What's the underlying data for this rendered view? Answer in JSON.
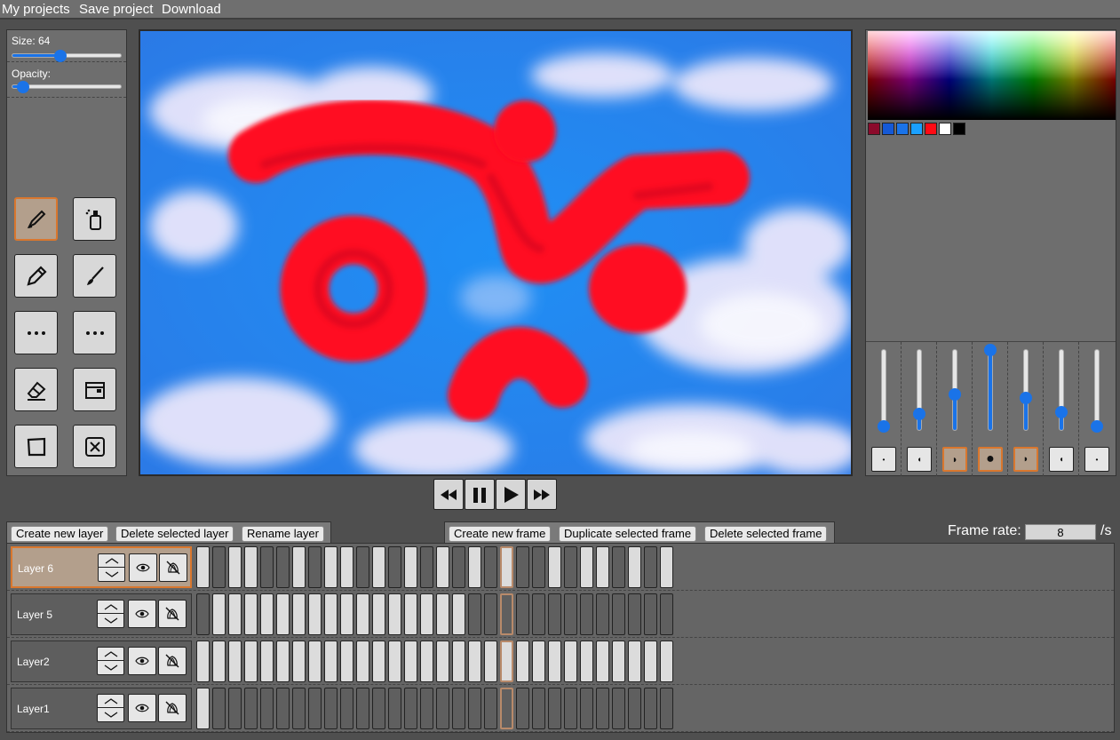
{
  "menu": {
    "items": [
      "My projects",
      "Save project",
      "Download"
    ]
  },
  "tools_panel": {
    "size_label": "Size: 64",
    "size_value": 64,
    "opacity_label": "Opacity:",
    "opacity_value": 0.1,
    "tools": [
      {
        "name": "brush-tool",
        "icon": "brush-icon",
        "active": true
      },
      {
        "name": "spray-tool",
        "icon": "spray-can-icon",
        "active": false
      },
      {
        "name": "pencil-tool",
        "icon": "pencil-icon",
        "active": false
      },
      {
        "name": "fine-brush-tool",
        "icon": "fine-brush-icon",
        "active": false
      },
      {
        "name": "dotted-tool-1",
        "icon": "dots-icon",
        "active": false
      },
      {
        "name": "dotted-tool-2",
        "icon": "dots-icon",
        "active": false
      },
      {
        "name": "eraser-tool",
        "icon": "eraser-icon",
        "active": false
      },
      {
        "name": "fill-tool",
        "icon": "fill-icon",
        "active": false
      },
      {
        "name": "rectangle-tool",
        "icon": "square-icon",
        "active": false
      },
      {
        "name": "clear-tool",
        "icon": "clear-icon",
        "active": false
      }
    ]
  },
  "colors": {
    "swatches": [
      "#8b0a2b",
      "#1559d6",
      "#1a73e8",
      "#1aa0ff",
      "#ff0a14",
      "#ffffff",
      "#000000"
    ],
    "accent": "#1a73e8",
    "active_border": "#d9772e",
    "active_bg": "#b39f8c"
  },
  "brush_shapes": [
    {
      "level": 0.05,
      "icon": "brush-shape-1-icon",
      "active": false
    },
    {
      "level": 0.2,
      "icon": "brush-shape-2-icon",
      "active": false
    },
    {
      "level": 0.45,
      "icon": "brush-shape-3-icon",
      "active": true
    },
    {
      "level": 1.0,
      "icon": "brush-shape-4-icon",
      "active": true
    },
    {
      "level": 0.4,
      "icon": "brush-shape-5-icon",
      "active": true
    },
    {
      "level": 0.22,
      "icon": "brush-shape-6-icon",
      "active": false
    },
    {
      "level": 0.05,
      "icon": "brush-shape-7-icon",
      "active": false
    }
  ],
  "playback": {
    "buttons": [
      "rewind-icon",
      "pause-icon",
      "play-icon",
      "fast-forward-icon"
    ]
  },
  "layer_controls": {
    "create": "Create new layer",
    "delete": "Delete selected layer",
    "rename": "Rename layer"
  },
  "frame_controls": {
    "create": "Create new frame",
    "duplicate": "Duplicate selected frame",
    "delete": "Delete selected frame"
  },
  "frame_rate": {
    "label": "Frame rate:",
    "value": "8",
    "unit": "/s"
  },
  "current_frame_index": 19,
  "layers": [
    {
      "name": "Layer 6",
      "active": true,
      "frames": [
        1,
        0,
        1,
        1,
        0,
        0,
        1,
        0,
        1,
        1,
        0,
        1,
        0,
        1,
        0,
        1,
        0,
        1,
        0,
        1,
        0,
        0,
        1,
        0,
        1,
        1,
        0,
        1,
        0,
        1
      ]
    },
    {
      "name": "Layer 5",
      "active": false,
      "frames": [
        0,
        1,
        1,
        1,
        1,
        1,
        1,
        1,
        1,
        1,
        1,
        1,
        1,
        1,
        1,
        1,
        1,
        0,
        0,
        0,
        0,
        0,
        0,
        0,
        0,
        0,
        0,
        0,
        0,
        0
      ]
    },
    {
      "name": "Layer2",
      "active": false,
      "frames": [
        1,
        1,
        1,
        1,
        1,
        1,
        1,
        1,
        1,
        1,
        1,
        1,
        1,
        1,
        1,
        1,
        1,
        1,
        1,
        1,
        1,
        1,
        1,
        1,
        1,
        1,
        1,
        1,
        1,
        1
      ]
    },
    {
      "name": "Layer1",
      "active": false,
      "frames": [
        1,
        0,
        0,
        0,
        0,
        0,
        0,
        0,
        0,
        0,
        0,
        0,
        0,
        0,
        0,
        0,
        0,
        0,
        0,
        0,
        0,
        0,
        0,
        0,
        0,
        0,
        0,
        0,
        0,
        0
      ]
    }
  ]
}
